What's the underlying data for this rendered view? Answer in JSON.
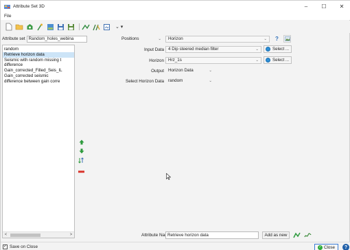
{
  "window": {
    "title": "Attribute Set 3D",
    "controls": {
      "minimize": "–",
      "maximize": "☐",
      "close": "✕"
    }
  },
  "menu": {
    "items": [
      "File"
    ]
  },
  "toolbar": {
    "more": "⌄ ▾"
  },
  "attribute_set": {
    "label": "Attribute set",
    "value": "Random_holes_webina"
  },
  "attribute_list": {
    "items": [
      "random",
      "Retrieve horizon data",
      "Seismic with random missing t",
      "difference",
      "Gain_corrected_Filled_Seis_IL",
      "Gain_corrected seismic",
      "difference between gain corre"
    ],
    "selected_index": 1
  },
  "selectors": {
    "category": "Positions",
    "method": "Horizon"
  },
  "form": {
    "input_data_label": "Input Data",
    "input_data_value": "4 Dip steered median filter",
    "horizon_label": "Horizon",
    "horizon_value": "Hrz_1s",
    "output_label": "Output",
    "output_value": "Horizon Data",
    "select_horizon_data_label": "Select Horizon Data",
    "select_horizon_data_value": "random",
    "select_button_label": "Select ..."
  },
  "bottom": {
    "attribute_name_label": "Attribute Name",
    "attribute_name_value": "Retrieve horizon data",
    "add_as_new_label": "Add as new"
  },
  "status": {
    "save_on_close_label": "Save on Close",
    "save_on_close_checked": true,
    "close_label": "Close",
    "help_label": "?"
  },
  "colors": {
    "selection": "#cce4f7",
    "accent_blue": "#2e8fd6",
    "close_green": "#2faa3a",
    "arrow_green": "#2c9a3c",
    "remove_red": "#d9342b"
  }
}
